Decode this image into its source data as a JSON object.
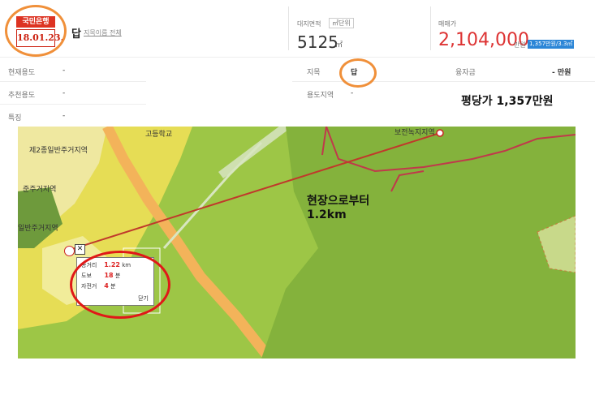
{
  "header": {
    "badge_top": "국민은행",
    "date": "18.01.23.",
    "category": "답",
    "full_link": "지목이름 전체",
    "area_label": "대지면적",
    "area_unit_button": "㎡단위",
    "area_value": "5125",
    "area_unit": "㎡",
    "price_label": "매매가",
    "price_value": "2,104,000",
    "price_unit": "만원",
    "price_badge": "1,357만원/3.3㎡"
  },
  "info": {
    "row1_label": "현재용도",
    "row1_value": "-",
    "row2_label": "추천용도",
    "row2_value": "-",
    "row3_label": "특징",
    "row3_value": "-",
    "jimok_label": "지목",
    "jimok_value": "답",
    "zone_label": "용도지역",
    "zone_value": "-",
    "loan_label": "융자금",
    "loan_value": "- 만원"
  },
  "annotation": {
    "price_per_pyeong": "평당가 1,357만원",
    "distance_line1": "현장으로부터",
    "distance_line2": "1.2km"
  },
  "map": {
    "labels": {
      "school": "고등학교",
      "zone1": "제2종일반주거지역",
      "zone2": "준주거지역",
      "zone3": "일반주거지역",
      "station": "보전녹지지역"
    },
    "popup": {
      "row1_label": "총거리",
      "row1_value": "1.22",
      "row1_unit": "km",
      "row2_label": "도보",
      "row2_value": "18",
      "row2_unit": "분",
      "row3_label": "자전거",
      "row3_value": "4",
      "row3_unit": "분",
      "close": "닫기"
    },
    "close_glyph": "✕"
  },
  "colors": {
    "accent_orange": "#f0903a",
    "price_red": "#d33",
    "annotation_red": "#e01818",
    "map_green": "#9dc646",
    "road_orange": "#f3b35a"
  }
}
